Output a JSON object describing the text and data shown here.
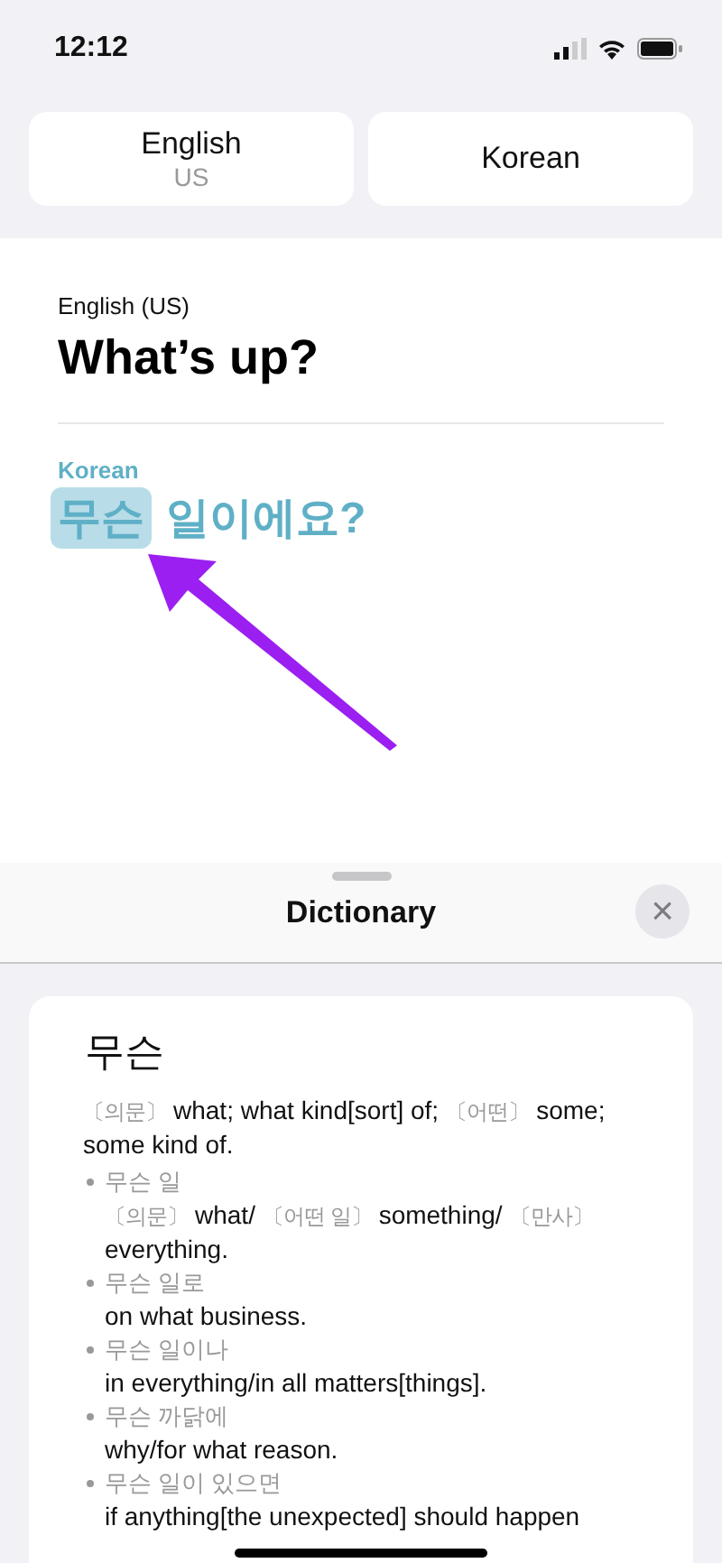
{
  "status_bar": {
    "time": "12:12"
  },
  "language_buttons": [
    {
      "name": "English",
      "region": "US"
    },
    {
      "name": "Korean"
    }
  ],
  "translation": {
    "source_label": "English (US)",
    "source_text": "What’s up?",
    "target_label": "Korean",
    "target_words": [
      {
        "text": "무슨",
        "selected": true
      },
      {
        "text": "일이에요?",
        "selected": false
      }
    ]
  },
  "dictionary": {
    "title": "Dictionary",
    "close": "×",
    "headword": "무슨",
    "definition": [
      {
        "kind": "tag",
        "text": "〔의문〕"
      },
      {
        "kind": "text",
        "text": "what; what kind[sort] of;"
      },
      {
        "kind": "tag",
        "text": "〔어떤〕"
      },
      {
        "kind": "text",
        "text": "some; some kind of."
      }
    ],
    "examples": [
      {
        "phrase": "무슨 일",
        "meaning": [
          {
            "kind": "tag",
            "text": "〔의문〕"
          },
          {
            "kind": "text",
            "text": "what/"
          },
          {
            "kind": "tag",
            "text": "〔어떤 일〕"
          },
          {
            "kind": "text",
            "text": "something/"
          },
          {
            "kind": "tag",
            "text": "〔만사〕"
          },
          {
            "kind": "text",
            "text": "everything."
          }
        ]
      },
      {
        "phrase": "무슨 일로",
        "meaning": [
          {
            "kind": "text",
            "text": "on what business."
          }
        ]
      },
      {
        "phrase": "무슨 일이나",
        "meaning": [
          {
            "kind": "text",
            "text": "in everything/in all matters[things]."
          }
        ]
      },
      {
        "phrase": "무슨 까닭에",
        "meaning": [
          {
            "kind": "text",
            "text": "why/for what reason."
          }
        ]
      },
      {
        "phrase": "무슨 일이 있으면",
        "meaning": [
          {
            "kind": "text",
            "text": "if anything[the unexpected] should happen"
          }
        ]
      }
    ]
  }
}
